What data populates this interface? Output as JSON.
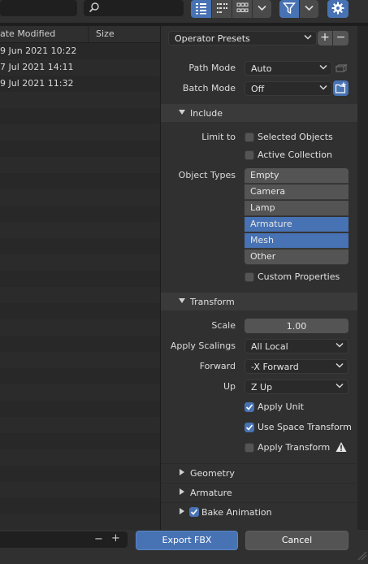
{
  "toolbar": {
    "search_placeholder": "",
    "view_modes": [
      "vertical-list",
      "horizontal-list",
      "thumbnails"
    ],
    "icons": [
      "search-icon",
      "filter-icon",
      "gear-icon"
    ]
  },
  "file_list": {
    "columns": [
      "Date Modified",
      "Size"
    ],
    "column_date_visible": "ate Modified",
    "rows": [
      {
        "date": "9 Jun 2021 10:22",
        "size": ""
      },
      {
        "date": "7 Jul 2021 14:11",
        "size": ""
      },
      {
        "date": "9 Jul 2021 11:32",
        "size": ""
      }
    ],
    "path_controls": [
      "−",
      "+"
    ]
  },
  "operator_presets": {
    "label": "Operator Presets",
    "add": "+",
    "remove": "−"
  },
  "path_mode": {
    "label": "Path Mode",
    "value": "Auto"
  },
  "batch_mode": {
    "label": "Batch Mode",
    "value": "Off"
  },
  "include": {
    "title": "Include",
    "limit_to_label": "Limit to",
    "selected_objects": {
      "label": "Selected Objects",
      "checked": false
    },
    "active_collection": {
      "label": "Active Collection",
      "checked": false
    },
    "object_types_label": "Object Types",
    "object_types": [
      {
        "label": "Empty",
        "selected": false
      },
      {
        "label": "Camera",
        "selected": false
      },
      {
        "label": "Lamp",
        "selected": false
      },
      {
        "label": "Armature",
        "selected": true
      },
      {
        "label": "Mesh",
        "selected": true
      },
      {
        "label": "Other",
        "selected": false
      }
    ],
    "custom_properties": {
      "label": "Custom Properties",
      "checked": false
    }
  },
  "transform": {
    "title": "Transform",
    "scale": {
      "label": "Scale",
      "value": "1.00"
    },
    "apply_scalings": {
      "label": "Apply Scalings",
      "value": "All Local"
    },
    "forward": {
      "label": "Forward",
      "value": "-X Forward"
    },
    "up": {
      "label": "Up",
      "value": "Z Up"
    },
    "apply_unit": {
      "label": "Apply Unit",
      "checked": true
    },
    "use_space_transform": {
      "label": "Use Space Transform",
      "checked": true
    },
    "apply_transform": {
      "label": "Apply Transform",
      "checked": false
    }
  },
  "sections": {
    "geometry": "Geometry",
    "armature": "Armature",
    "bake_animation": {
      "label": "Bake Animation",
      "checked": true
    }
  },
  "actions": {
    "export": "Export FBX",
    "cancel": "Cancel"
  },
  "colors": {
    "accent": "#4772b3",
    "panel": "#303030",
    "background": "#1d1d1d"
  }
}
